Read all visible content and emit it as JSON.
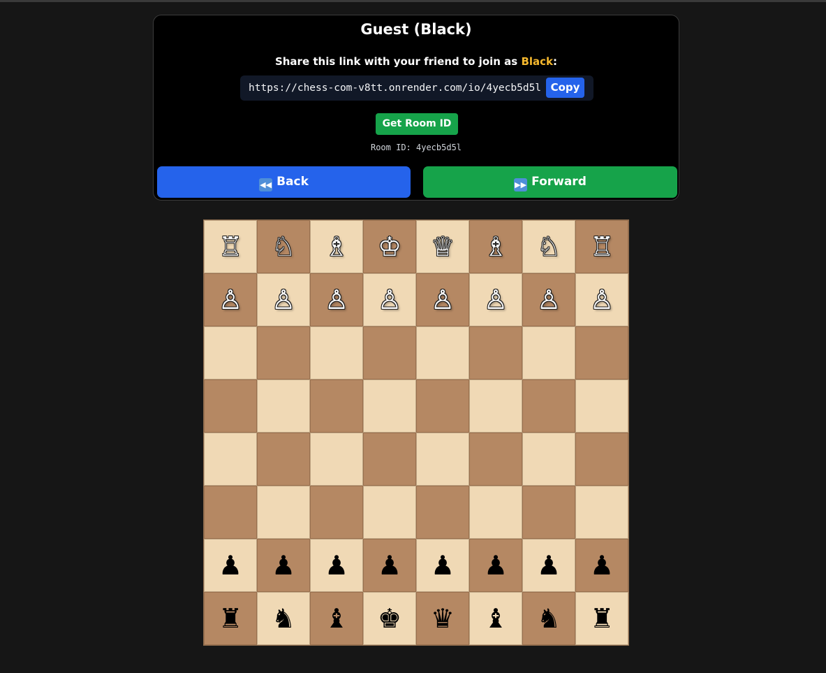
{
  "panel": {
    "title": "Guest (Black)",
    "share_prefix": "Share this link with your friend to join as ",
    "share_color": "Black",
    "share_suffix": ":",
    "link_url": "https://chess-com-v8tt.onrender.com/io/4yecb5d5l",
    "copy_label": "Copy",
    "get_room_label": "Get Room ID",
    "room_id_text": "Room ID: 4yecb5d5l",
    "back_label": "Back",
    "back_icon": "rewind-icon",
    "forward_label": "Forward",
    "forward_icon": "fast-forward-icon"
  },
  "colors": {
    "page_bg": "#161616",
    "panel_bg": "#000000",
    "accent_blue": "#2563eb",
    "accent_green": "#16a34a",
    "highlight_yellow": "#f5b82e",
    "light_square": "#f0d9b5",
    "dark_square": "#b58863"
  },
  "board": {
    "orientation": "black-at-bottom",
    "ranks": [
      [
        {
          "type": "rook",
          "color": "white"
        },
        {
          "type": "knight",
          "color": "white"
        },
        {
          "type": "bishop",
          "color": "white"
        },
        {
          "type": "king",
          "color": "white"
        },
        {
          "type": "queen",
          "color": "white"
        },
        {
          "type": "bishop",
          "color": "white"
        },
        {
          "type": "knight",
          "color": "white"
        },
        {
          "type": "rook",
          "color": "white"
        }
      ],
      [
        {
          "type": "pawn",
          "color": "white"
        },
        {
          "type": "pawn",
          "color": "white"
        },
        {
          "type": "pawn",
          "color": "white"
        },
        {
          "type": "pawn",
          "color": "white"
        },
        {
          "type": "pawn",
          "color": "white"
        },
        {
          "type": "pawn",
          "color": "white"
        },
        {
          "type": "pawn",
          "color": "white"
        },
        {
          "type": "pawn",
          "color": "white"
        }
      ],
      [
        null,
        null,
        null,
        null,
        null,
        null,
        null,
        null
      ],
      [
        null,
        null,
        null,
        null,
        null,
        null,
        null,
        null
      ],
      [
        null,
        null,
        null,
        null,
        null,
        null,
        null,
        null
      ],
      [
        null,
        null,
        null,
        null,
        null,
        null,
        null,
        null
      ],
      [
        {
          "type": "pawn",
          "color": "black"
        },
        {
          "type": "pawn",
          "color": "black"
        },
        {
          "type": "pawn",
          "color": "black"
        },
        {
          "type": "pawn",
          "color": "black"
        },
        {
          "type": "pawn",
          "color": "black"
        },
        {
          "type": "pawn",
          "color": "black"
        },
        {
          "type": "pawn",
          "color": "black"
        },
        {
          "type": "pawn",
          "color": "black"
        }
      ],
      [
        {
          "type": "rook",
          "color": "black"
        },
        {
          "type": "knight",
          "color": "black"
        },
        {
          "type": "bishop",
          "color": "black"
        },
        {
          "type": "king",
          "color": "black"
        },
        {
          "type": "queen",
          "color": "black"
        },
        {
          "type": "bishop",
          "color": "black"
        },
        {
          "type": "knight",
          "color": "black"
        },
        {
          "type": "rook",
          "color": "black"
        }
      ]
    ]
  }
}
